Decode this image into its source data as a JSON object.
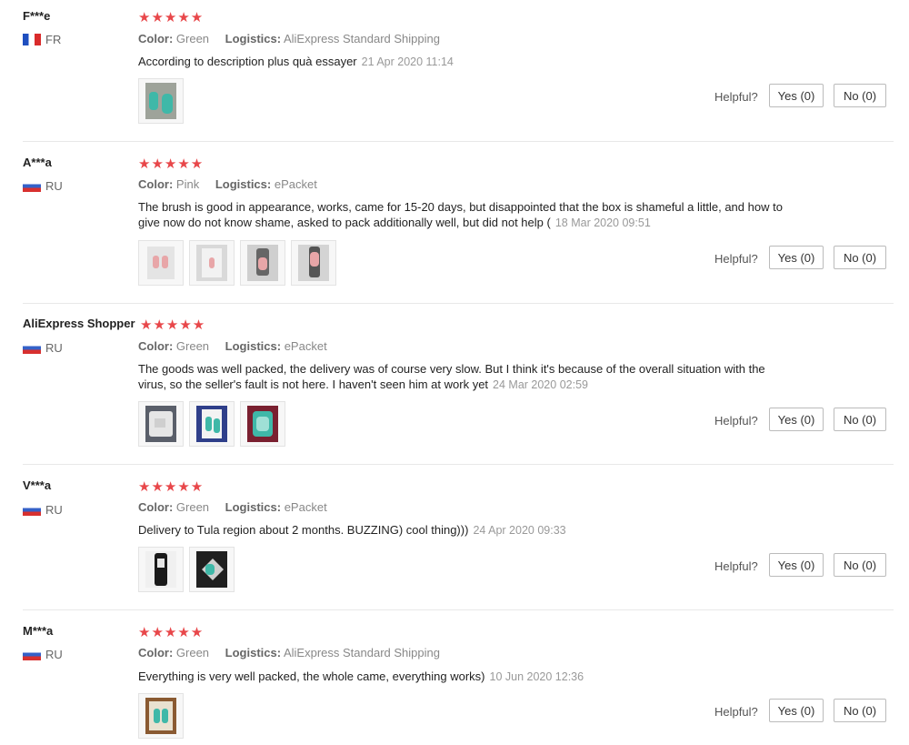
{
  "labels": {
    "color": "Color:",
    "logistics": "Logistics:",
    "helpful": "Helpful?",
    "yes": "Yes (0)",
    "no": "No (0)",
    "stars": "★★★★★"
  },
  "reviews": [
    {
      "name": "F***e",
      "country": "FR",
      "flag": "fr",
      "color": "Green",
      "logistics": "AliExpress Standard Shipping",
      "text": "According to description plus quà essayer",
      "date": "21 Apr 2020 11:14",
      "rating": 5,
      "photos": 1
    },
    {
      "name": "A***a",
      "country": "RU",
      "flag": "ru",
      "color": "Pink",
      "logistics": "ePacket",
      "text": "The brush is good in appearance, works, came for 15-20 days, but disappointed that the box is shameful a little, and how to give now do not know shame, asked to pack additionally well, but did not help (",
      "date": "18 Mar 2020 09:51",
      "rating": 5,
      "photos": 4
    },
    {
      "name": "AliExpress Shopper",
      "country": "RU",
      "flag": "ru",
      "color": "Green",
      "logistics": "ePacket",
      "text": "The goods was well packed, the delivery was of course very slow. But I think it's because of the overall situation with the virus, so the seller's fault is not here. I haven't seen him at work yet",
      "date": "24 Mar 2020 02:59",
      "rating": 5,
      "photos": 3
    },
    {
      "name": "V***a",
      "country": "RU",
      "flag": "ru",
      "color": "Green",
      "logistics": "ePacket",
      "text": "Delivery to Tula region about 2 months. BUZZING) cool thing)))",
      "date": "24 Apr 2020 09:33",
      "rating": 5,
      "photos": 2
    },
    {
      "name": "M***a",
      "country": "RU",
      "flag": "ru",
      "color": "Green",
      "logistics": "AliExpress Standard Shipping",
      "text": "Everything is very well packed, the whole came, everything works)",
      "date": "10 Jun 2020 12:36",
      "rating": 5,
      "photos": 1
    }
  ],
  "colors": {
    "star": "#e8474a",
    "photo_green": "#3fb8a8",
    "photo_pink": "#e8a6a8"
  }
}
